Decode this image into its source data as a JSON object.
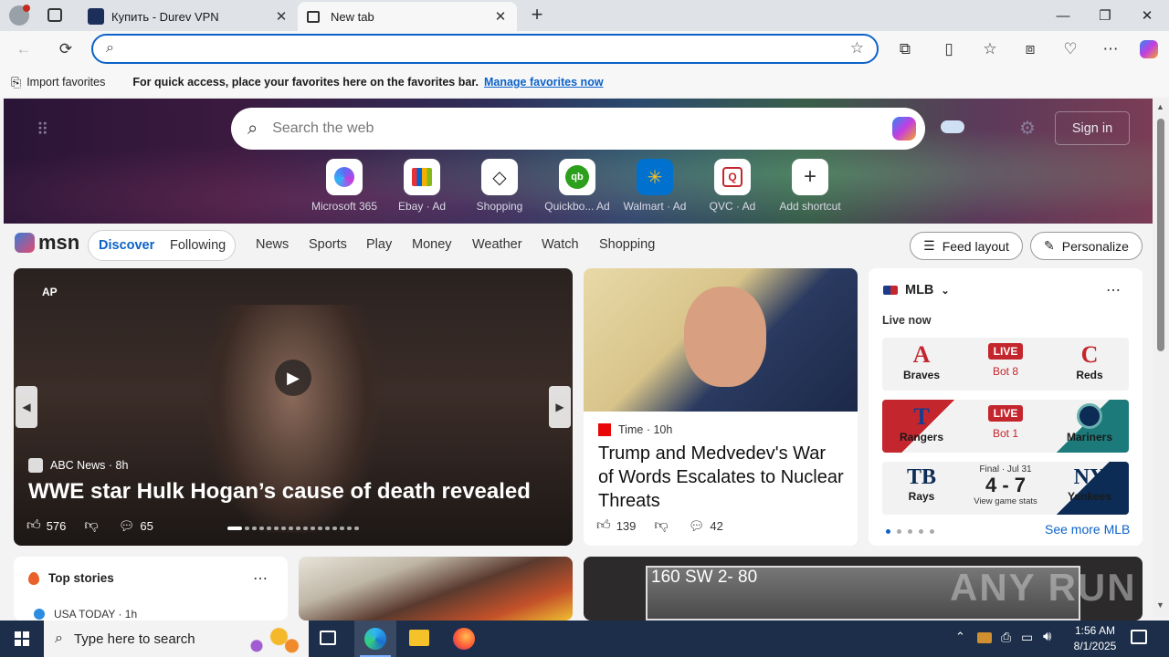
{
  "browser": {
    "tabs": [
      {
        "title": "Купить - Durev VPN",
        "active": false
      },
      {
        "title": "New tab",
        "active": true
      }
    ],
    "favorites_bar": {
      "import_label": "Import favorites",
      "message": "For quick access, place your favorites here on the favorites bar.",
      "manage_link": "Manage favorites now"
    }
  },
  "newtab": {
    "search_placeholder": "Search the web",
    "sign_in": "Sign in",
    "shortcuts": [
      {
        "label": "Microsoft 365",
        "ad": ""
      },
      {
        "label": "Ebay",
        "ad": "· Ad"
      },
      {
        "label": "Shopping",
        "ad": ""
      },
      {
        "label": "Quickbo...",
        "ad": "Ad"
      },
      {
        "label": "Walmart",
        "ad": "· Ad"
      },
      {
        "label": "QVC",
        "ad": "· Ad"
      },
      {
        "label": "Add shortcut",
        "ad": ""
      }
    ]
  },
  "msn": {
    "logo": "msn",
    "tabs": [
      "Discover",
      "Following"
    ],
    "nav": [
      "News",
      "Sports",
      "Play",
      "Money",
      "Weather",
      "Watch",
      "Shopping"
    ],
    "feed_layout": "Feed layout",
    "personalize": "Personalize"
  },
  "hero_card": {
    "badge": "AP",
    "source": "ABC News",
    "age": "· 8h",
    "headline": "WWE star Hulk Hogan’s cause of death revealed",
    "likes": "576",
    "comments": "65"
  },
  "side_card": {
    "source": "Time",
    "age": "· 10h",
    "headline": "Trump and Medvedev's War of Words Escalates to Nuclear Threats",
    "likes": "139",
    "comments": "42"
  },
  "mlb": {
    "title": "MLB",
    "live_now": "Live now",
    "games": [
      {
        "home": "Braves",
        "away": "Reds",
        "status": "LIVE",
        "detail": "Bot 8"
      },
      {
        "home": "Rangers",
        "away": "Mariners",
        "status": "LIVE",
        "detail": "Bot 1"
      },
      {
        "home": "Rays",
        "away": "Yankees",
        "final": "Final · Jul 31",
        "score": "4 - 7",
        "detail": "View game stats"
      }
    ],
    "see_more": "See more MLB"
  },
  "top_stories": {
    "title": "Top stories",
    "first_source": "USA TODAY · 1h"
  },
  "video_card": {
    "overlay": "160 SW 2- 80"
  },
  "watermark": "ANY RUN",
  "taskbar": {
    "search_placeholder": "Type here to search",
    "time": "1:56 AM",
    "date": "8/1/2025"
  },
  "colors": {
    "accent": "#0c62c9",
    "live_red": "#c4262e",
    "taskbar": "#1c2e4a"
  }
}
